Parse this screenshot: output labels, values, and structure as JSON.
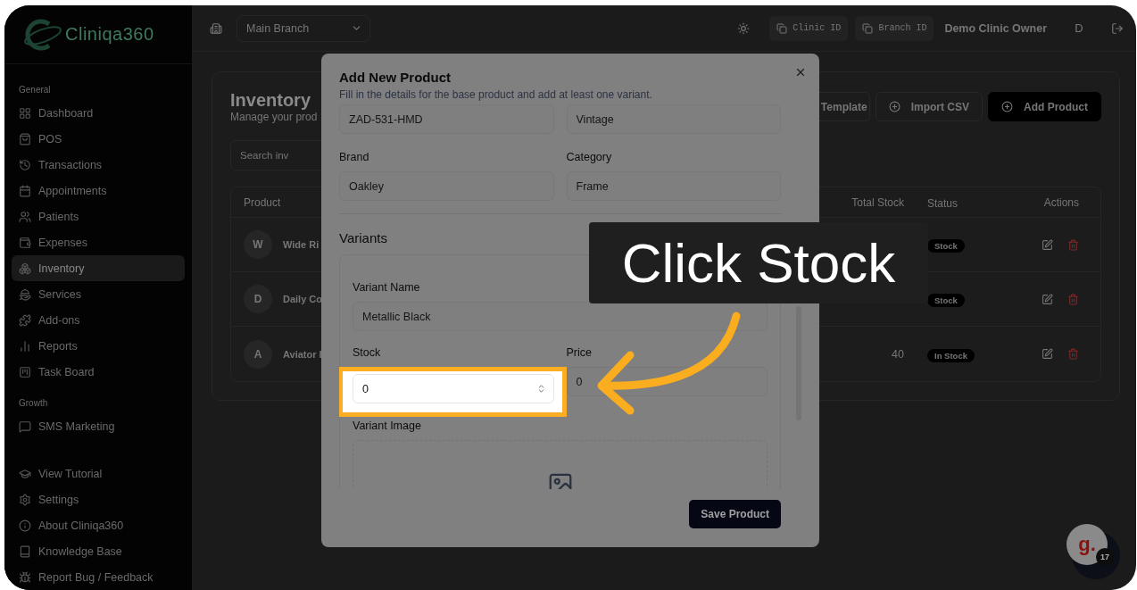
{
  "sidebar": {
    "logo": "Cliniqa360",
    "sections": [
      {
        "title": "General",
        "items": [
          {
            "label": "Dashboard",
            "selected": false
          },
          {
            "label": "POS",
            "selected": false
          },
          {
            "label": "Transactions",
            "selected": false
          },
          {
            "label": "Appointments",
            "selected": false
          },
          {
            "label": "Patients",
            "selected": false
          },
          {
            "label": "Expenses",
            "selected": false
          },
          {
            "label": "Inventory",
            "selected": true
          },
          {
            "label": "Services",
            "selected": false
          },
          {
            "label": "Add-ons",
            "selected": false
          },
          {
            "label": "Reports",
            "selected": false
          },
          {
            "label": "Task Board",
            "selected": false
          }
        ]
      },
      {
        "title": "Growth",
        "items": [
          {
            "label": "SMS Marketing",
            "selected": false
          }
        ]
      }
    ],
    "footer_items": [
      {
        "label": "View Tutorial"
      },
      {
        "label": "Settings"
      },
      {
        "label": "About Cliniqa360"
      },
      {
        "label": "Knowledge Base"
      },
      {
        "label": "Report Bug / Feedback"
      }
    ]
  },
  "top_bar": {
    "branch_select": "Main Branch",
    "clinic_id": "Clinic ID",
    "branch_id": "Branch ID",
    "user_name": "Demo Clinic Owner",
    "avatar": "D"
  },
  "page": {
    "title": "Inventory",
    "subtitle": "Manage your prod",
    "search_placeholder": "Search inv",
    "buttons": [
      {
        "label": "Template",
        "kind": "outline"
      },
      {
        "label": "Import CSV",
        "kind": "import"
      },
      {
        "label": "Add Product",
        "kind": "primary"
      }
    ],
    "columns": {
      "product": "Product",
      "stock": "Total Stock",
      "status": "Status",
      "actions": "Actions"
    },
    "rows": [
      {
        "initial": "W",
        "name": "Wide Ri",
        "status": "Stock"
      },
      {
        "initial": "D",
        "name": "Daily Co",
        "status": "Stock"
      },
      {
        "initial": "A",
        "name": "Aviator I",
        "stock": "40",
        "status": "In Stock"
      }
    ]
  },
  "modal": {
    "title": "Add New Product",
    "subtitle": "Fill in the details for the base product and add at least one variant.",
    "fields": [
      {
        "value": "ZAD-531-HMD"
      },
      {
        "value": "Vintage"
      },
      {
        "label": "Brand",
        "value": "Oakley"
      },
      {
        "label": "Category",
        "value": "Frame"
      }
    ],
    "section_title": "Variants",
    "variant": {
      "name_label": "Variant Name",
      "name_value": "Metallic Black",
      "stock_label": "Stock",
      "stock_value": "0",
      "stock_highlighted": true,
      "price_label": "Price",
      "price_value": "0",
      "image_label": "Variant Image"
    },
    "save_button": "Save Product"
  },
  "callout": {
    "text": "Click Stock"
  },
  "help_widget": {
    "logo": "g.",
    "badge": "17"
  }
}
